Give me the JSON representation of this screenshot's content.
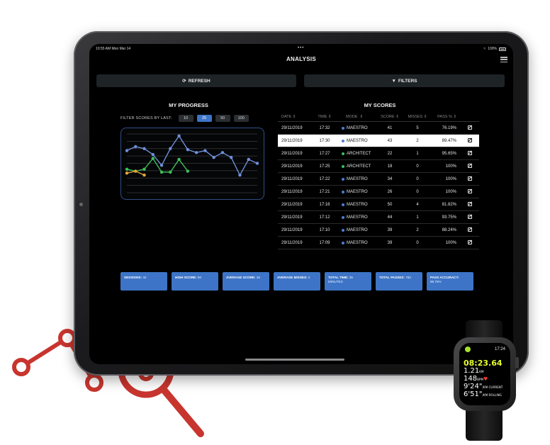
{
  "status_bar": {
    "time": "10:55 AM  Mon Mar 14",
    "dots": "•••",
    "battery": "100%"
  },
  "nav": {
    "title": "ANALYSIS"
  },
  "buttons": {
    "refresh": "REFRESH",
    "filters": "FILTERS"
  },
  "progress": {
    "title": "MY PROGRESS",
    "filter_label": "FILTER SCORES BY LAST:",
    "filter_options": [
      "10",
      "25",
      "50",
      "100"
    ],
    "filter_selected": "25"
  },
  "scores": {
    "title": "MY SCORES",
    "headers": {
      "date": "DATE",
      "time": "TIME",
      "mode": "MODE",
      "score": "SCORE",
      "misses": "MISSES",
      "pass": "PASS %"
    },
    "rows": [
      {
        "date": "29/11/2019",
        "time": "17:32",
        "mode": "MAESTRO",
        "score": "41",
        "misses": "5",
        "pass": "76.19%"
      },
      {
        "date": "29/11/2019",
        "time": "17:30",
        "mode": "MAESTRO",
        "score": "43",
        "misses": "2",
        "pass": "89.47%"
      },
      {
        "date": "29/11/2019",
        "time": "17:27",
        "mode": "ARCHITECT",
        "score": "22",
        "misses": "1",
        "pass": "95.65%"
      },
      {
        "date": "29/11/2019",
        "time": "17:25",
        "mode": "ARCHITECT",
        "score": "18",
        "misses": "0",
        "pass": "100%"
      },
      {
        "date": "29/11/2019",
        "time": "17:22",
        "mode": "MAESTRO",
        "score": "34",
        "misses": "0",
        "pass": "100%"
      },
      {
        "date": "29/11/2019",
        "time": "17:21",
        "mode": "MAESTRO",
        "score": "26",
        "misses": "0",
        "pass": "100%"
      },
      {
        "date": "29/11/2019",
        "time": "17:16",
        "mode": "MAESTRO",
        "score": "50",
        "misses": "4",
        "pass": "81.82%"
      },
      {
        "date": "29/11/2019",
        "time": "17:12",
        "mode": "MAESTRO",
        "score": "44",
        "misses": "1",
        "pass": "93.75%"
      },
      {
        "date": "29/11/2019",
        "time": "17:10",
        "mode": "MAESTRO",
        "score": "39",
        "misses": "2",
        "pass": "88.24%"
      },
      {
        "date": "29/11/2019",
        "time": "17:09",
        "mode": "MAESTRO",
        "score": "39",
        "misses": "0",
        "pass": "100%"
      }
    ],
    "highlighted_row": 1,
    "mode_colors": {
      "MAESTRO": "#4a7fd4",
      "ARCHITECT": "#3fbf5a"
    }
  },
  "stats": [
    {
      "label": "SESSIONS:",
      "value": "42"
    },
    {
      "label": "HIGH SCORE:",
      "value": "50"
    },
    {
      "label": "AVERAGE SCORE:",
      "value": "26"
    },
    {
      "label": "AVERAGE MISSES:",
      "value": "2"
    },
    {
      "label": "TOTAL TIME:",
      "value": "35 MINUTES"
    },
    {
      "label": "TOTAL PASSES:",
      "value": "782"
    },
    {
      "label": "PASS ACCURACY:",
      "value": "88.75%"
    }
  ],
  "chart_data": {
    "type": "line",
    "title": "",
    "xlabel": "",
    "ylabel": "",
    "ylim": [
      0,
      60
    ],
    "grid": true,
    "series": [
      {
        "color": "#6f8fd8",
        "values": [
          43,
          47,
          45,
          39,
          28,
          45,
          58,
          44,
          41,
          43,
          36,
          41,
          36,
          18,
          34,
          30
        ]
      },
      {
        "color": "#3fbf5a",
        "values": [
          24,
          22,
          24,
          35,
          21,
          21,
          34,
          22
        ]
      },
      {
        "color": "#e0a83a",
        "values": [
          20,
          22,
          18
        ]
      }
    ]
  },
  "watch": {
    "time": "17:24",
    "duration": "08:23.64",
    "distance": "1.21",
    "distance_unit": "KM",
    "bpm": "148",
    "bpm_unit": "BPM",
    "current_pace": "9'24\"",
    "current_label": "/KM CURRENT",
    "rolling_pace": "6'51\"",
    "rolling_label": "/KM ROLLING"
  },
  "decor": {
    "accent": "#c8352e"
  }
}
